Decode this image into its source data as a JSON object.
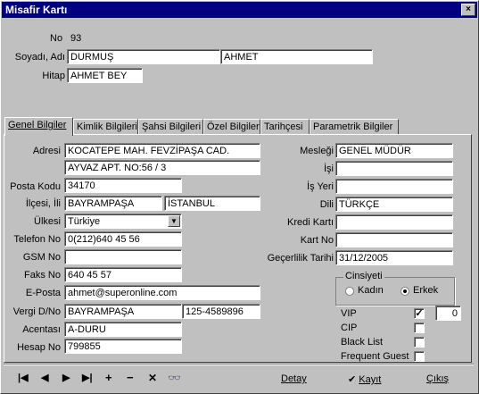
{
  "window": {
    "title": "Misafir Kartı",
    "close_glyph": "×"
  },
  "header": {
    "no_label": "No",
    "no_value": "93",
    "soyadi_adi_label": "Soyadı, Adı",
    "soyadi_value": "DURMUŞ",
    "adi_value": "AHMET",
    "hitap_label": "Hitap",
    "hitap_value": "AHMET BEY"
  },
  "tabs": [
    {
      "label": "Genel Bilgiler"
    },
    {
      "label": "Kimlik Bilgileri"
    },
    {
      "label": "Şahsi Bilgileri"
    },
    {
      "label": "Özel Bilgiler"
    },
    {
      "label": "Tarihçesi"
    },
    {
      "label": "Parametrik Bilgiler"
    }
  ],
  "left": {
    "adresi_label": "Adresi",
    "adres1": "KOCATEPE MAH. FEVZİPAŞA CAD.",
    "adres2": "AYVAZ APT. NO:56 / 3",
    "posta_kodu_label": "Posta Kodu",
    "posta_kodu": "34170",
    "ilcesi_ili_label": "İlçesi, İli",
    "ilcesi": "BAYRAMPAŞA",
    "ili": "İSTANBUL",
    "ulkesi_label": "Ülkesi",
    "ulkesi": "Türkiye",
    "telefon_label": "Telefon No",
    "telefon": "0(212)640 45 56",
    "gsm_label": "GSM No",
    "gsm": "",
    "faks_label": "Faks No",
    "faks": "640 45 57",
    "eposta_label": "E-Posta",
    "eposta": "ahmet@superonline.com",
    "vergi_label": "Vergi D/No",
    "vergi_daire": "BAYRAMPAŞA",
    "vergi_no": "125-4589896",
    "acenta_label": "Acentası",
    "acenta": "A-DURU",
    "hesap_label": "Hesap No",
    "hesap": "799855"
  },
  "right": {
    "meslegi_label": "Mesleği",
    "meslegi": "GENEL MÜDÜR",
    "isi_label": "İşi",
    "isi": "",
    "is_yeri_label": "İş Yeri",
    "is_yeri": "",
    "dili_label": "Dili",
    "dili": "TÜRKÇE",
    "kredi_karti_label": "Kredi Kartı",
    "kredi_karti": "",
    "kart_no_label": "Kart No",
    "kart_no": "",
    "gecerlilik_label": "Geçerlilik Tarihi",
    "gecerlilik": "31/12/2005",
    "cinsiyet": {
      "caption": "Cinsiyeti",
      "kadin": "Kadın",
      "erkek": "Erkek",
      "selected": "Erkek"
    },
    "vip_label": "VIP",
    "vip_checked": true,
    "vip_count": "0",
    "cip_label": "CIP",
    "cip_checked": false,
    "blacklist_label": "Black List",
    "blacklist_checked": false,
    "frequent_label": "Frequent Guest",
    "frequent_checked": false,
    "check_glyph": "✓"
  },
  "toolbar": {
    "first_glyph": "|◀",
    "prev_glyph": "◀",
    "next_glyph": "▶",
    "last_glyph": "▶|",
    "add_glyph": "+",
    "remove_glyph": "−",
    "cancel_glyph": "✕",
    "find_glyph": "👓",
    "detay_label": "Detay",
    "kayit_label": "Kayıt",
    "kayit_glyph": "✔",
    "cikis_label": "Çıkış"
  }
}
